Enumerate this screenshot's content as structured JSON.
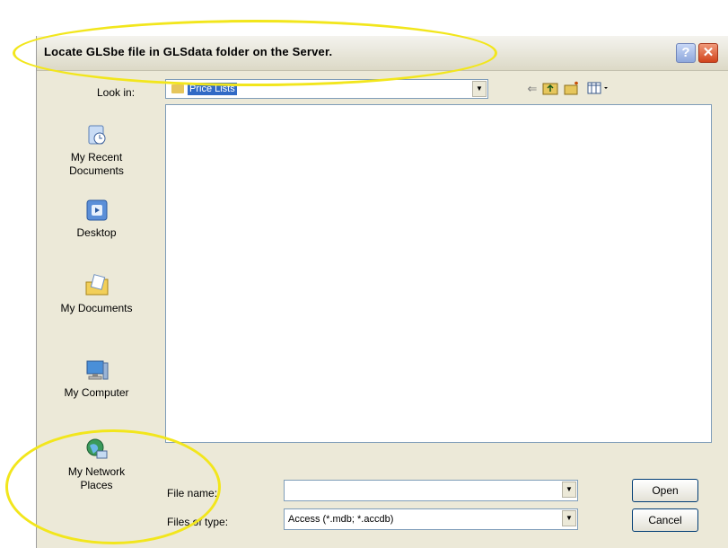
{
  "dialog": {
    "title": "Locate GLSbe file in GLSdata folder on the Server.",
    "help_symbol": "?",
    "close_symbol": "✕"
  },
  "lookin": {
    "label": "Look in:",
    "value": "Price Lists"
  },
  "toolbar": {
    "icons": [
      "back-arrow-icon",
      "up-folder-icon",
      "new-folder-icon",
      "view-menu-icon"
    ]
  },
  "places": [
    {
      "label_line1": "My Recent",
      "label_line2": "Documents",
      "icon": "recent-documents-icon"
    },
    {
      "label_line1": "Desktop",
      "label_line2": "",
      "icon": "desktop-icon"
    },
    {
      "label_line1": "My Documents",
      "label_line2": "",
      "icon": "my-documents-icon"
    },
    {
      "label_line1": "My Computer",
      "label_line2": "",
      "icon": "my-computer-icon"
    },
    {
      "label_line1": "My Network",
      "label_line2": "Places",
      "icon": "network-places-icon"
    }
  ],
  "filename": {
    "label": "File name:",
    "value": ""
  },
  "filetype": {
    "label": "Files of type:",
    "value": "Access (*.mdb; *.accdb)"
  },
  "buttons": {
    "open": "Open",
    "cancel": "Cancel"
  },
  "colors": {
    "highlight": "#f2e61c",
    "selection": "#316ac5"
  }
}
